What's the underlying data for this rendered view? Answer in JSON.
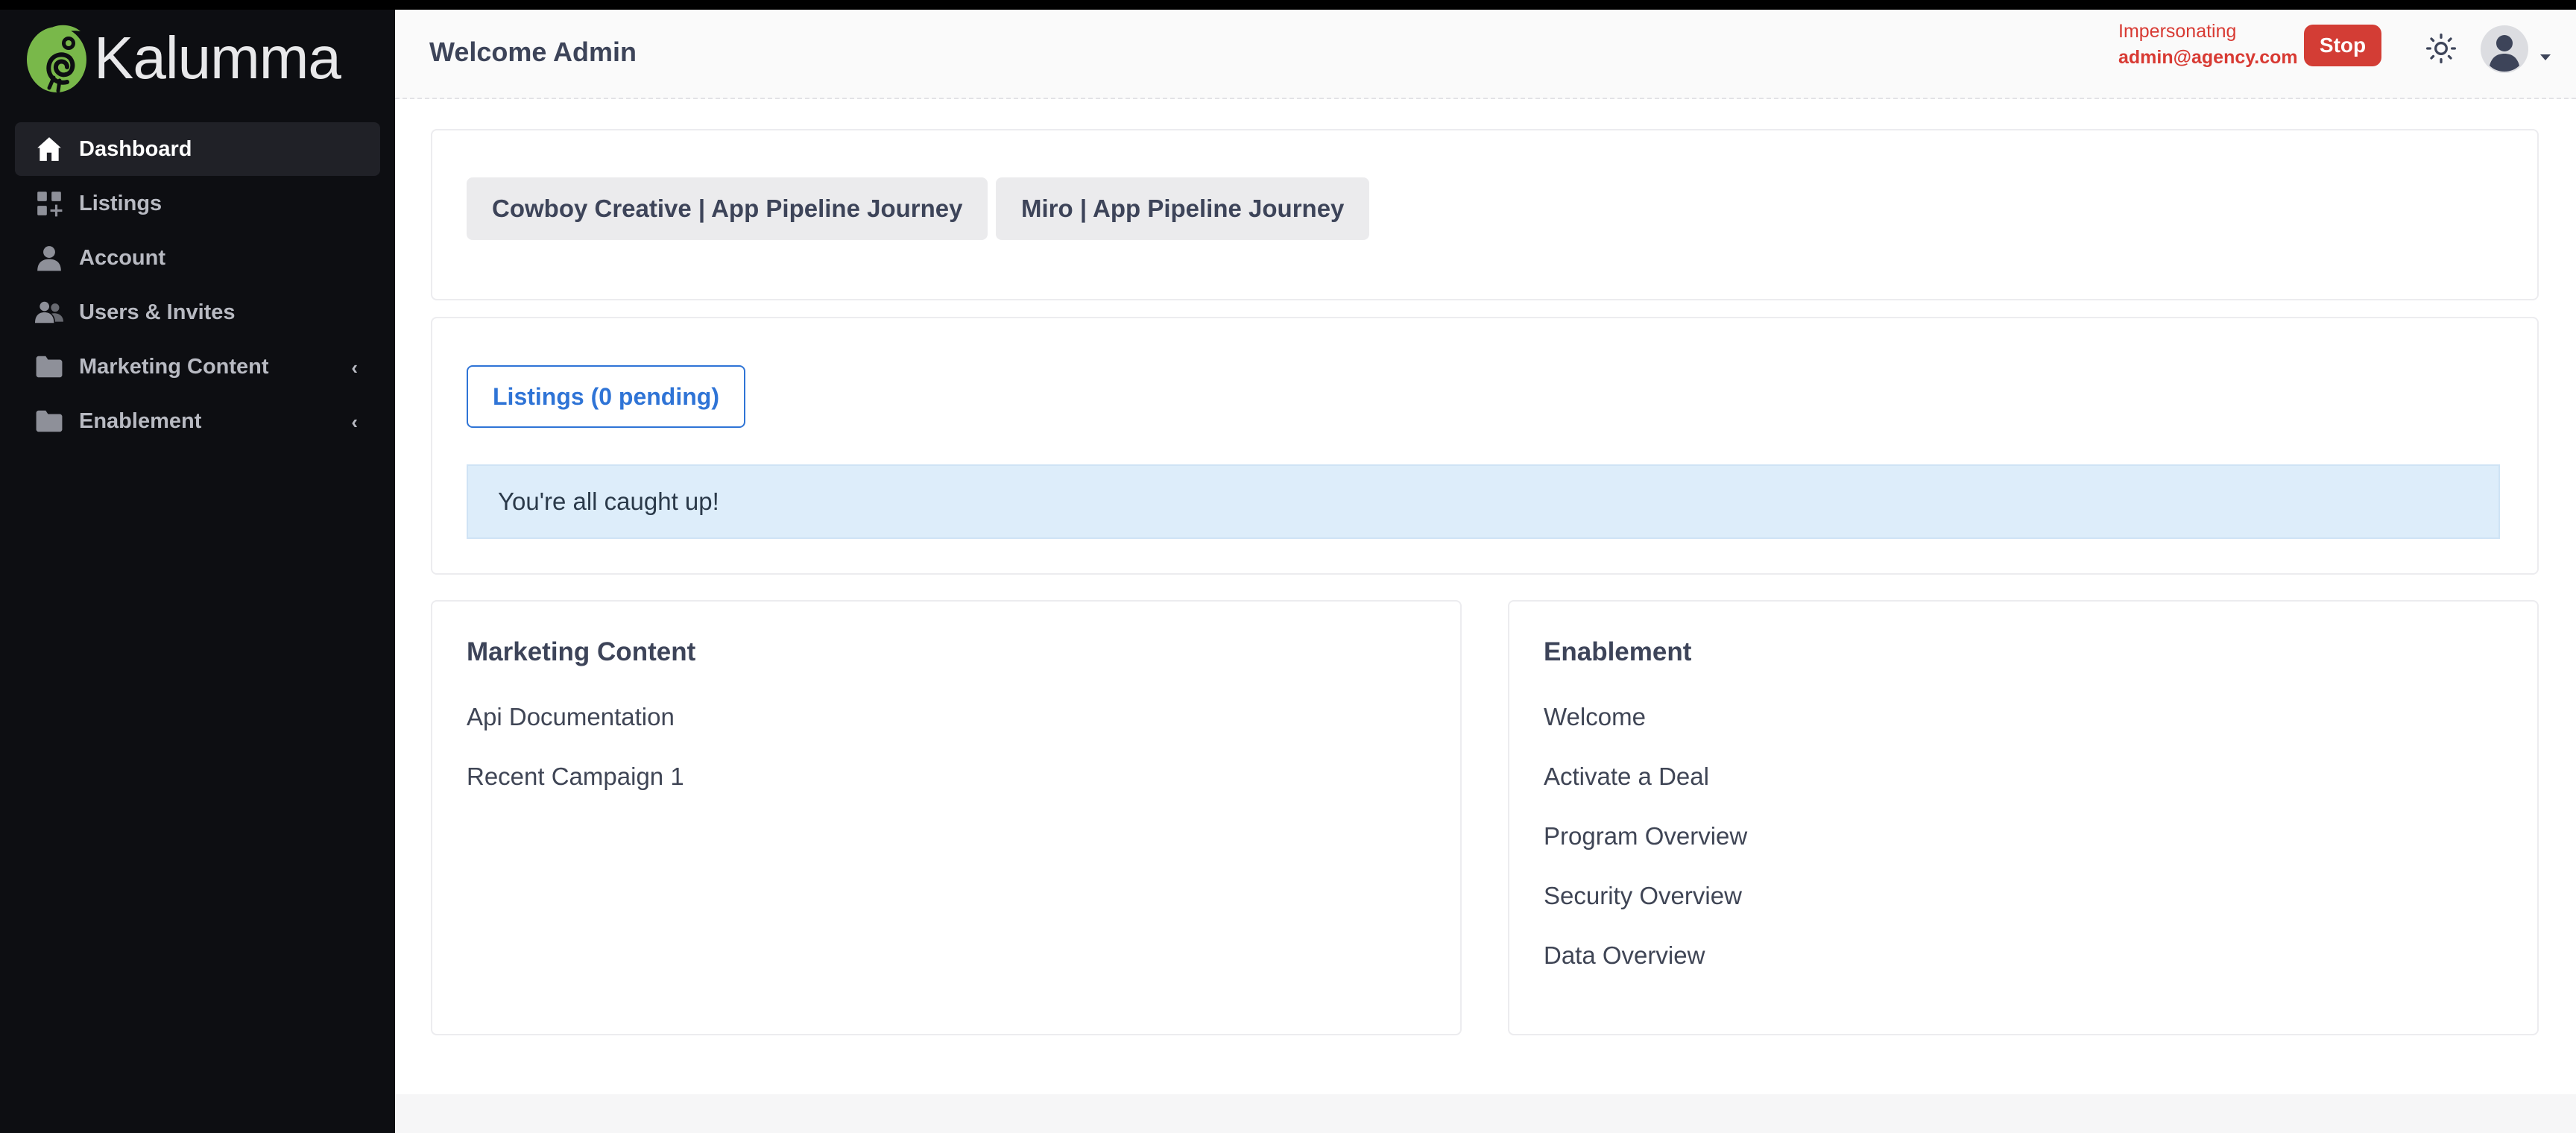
{
  "brand": {
    "name": "Kalumma",
    "accent": "#79b84a"
  },
  "sidebar": {
    "items": [
      {
        "label": "Dashboard",
        "icon": "home-icon",
        "active": true
      },
      {
        "label": "Listings",
        "icon": "grid-plus-icon"
      },
      {
        "label": "Account",
        "icon": "person-icon"
      },
      {
        "label": "Users & Invites",
        "icon": "users-icon"
      },
      {
        "label": "Marketing Content",
        "icon": "folder-icon",
        "chevron": "‹"
      },
      {
        "label": "Enablement",
        "icon": "folder-icon",
        "chevron": "‹"
      }
    ]
  },
  "header": {
    "welcome": "Welcome Admin",
    "impersonating_label": "Impersonating",
    "impersonating_email": "admin@agency.com",
    "stop_label": "Stop",
    "theme_icon": "sun-icon",
    "avatar_icon": "user-avatar-icon"
  },
  "journeys": [
    {
      "label": "Cowboy Creative | App Pipeline Journey"
    },
    {
      "label": "Miro | App Pipeline Journey"
    }
  ],
  "listings": {
    "button_label": "Listings (0 pending)",
    "status_message": "You're all caught up!"
  },
  "marketing": {
    "title": "Marketing Content",
    "items": [
      "Api Documentation",
      "Recent Campaign 1"
    ]
  },
  "enablement": {
    "title": "Enablement",
    "items": [
      "Welcome",
      "Activate a Deal",
      "Program Overview",
      "Security Overview",
      "Data Overview"
    ]
  },
  "colors": {
    "sidebar_bg": "#0d0e12",
    "danger": "#d33d35",
    "primary": "#2f74d6",
    "info_bg": "#ddedfa"
  }
}
